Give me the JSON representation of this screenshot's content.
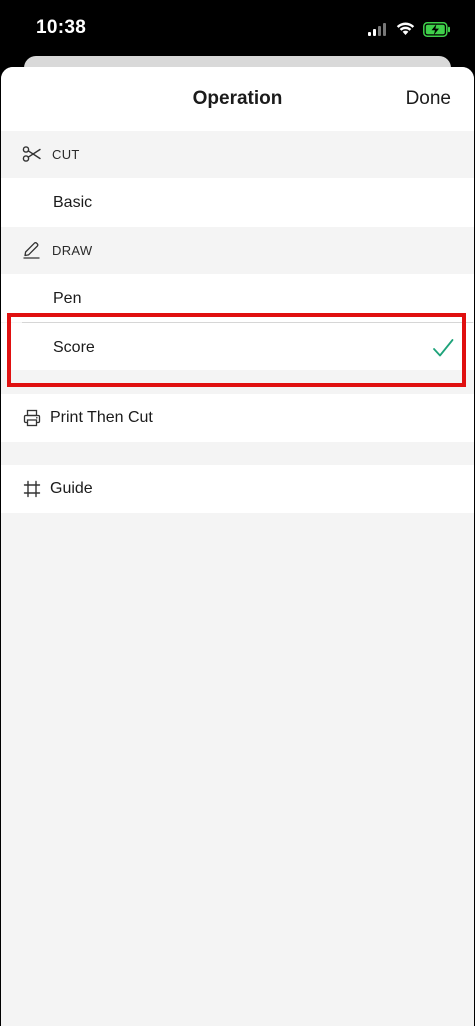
{
  "status_bar": {
    "time": "10:38"
  },
  "sheet": {
    "title": "Operation",
    "done_label": "Done"
  },
  "sections": {
    "cut": {
      "label": "CUT",
      "icon": "scissors-icon",
      "items": [
        "Basic"
      ]
    },
    "draw": {
      "label": "DRAW",
      "icon": "pen-icon",
      "items": [
        "Pen",
        "Score"
      ]
    }
  },
  "selected_item": "Score",
  "other_rows": {
    "print_then_cut": {
      "label": "Print Then Cut",
      "icon": "printer-icon"
    },
    "guide": {
      "label": "Guide",
      "icon": "grid-hash-icon"
    }
  },
  "colors": {
    "check": "#1ea37a",
    "highlight": "#e01010",
    "background": "#f4f4f4"
  }
}
